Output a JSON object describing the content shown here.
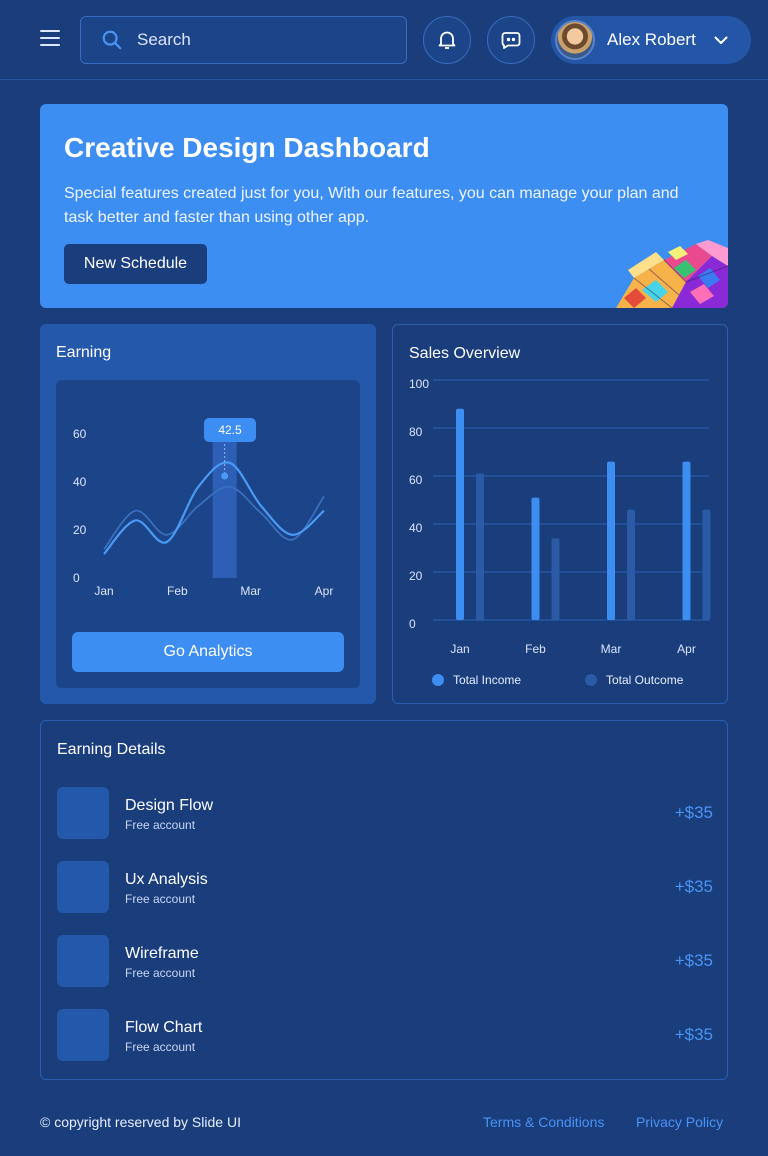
{
  "header": {
    "search_placeholder": "Search",
    "user_name": "Alex Robert"
  },
  "banner": {
    "title": "Creative Design Dashboard",
    "description": "Special features created just for you, With our features, you can manage your plan and task better and faster than using other app.",
    "button_label": "New Schedule"
  },
  "earning": {
    "title": "Earning",
    "tooltip": "42.5",
    "button_label": "Go Analytics"
  },
  "sales": {
    "title": "Sales Overview",
    "legend_income": "Total Income",
    "legend_outcome": "Total Outcome"
  },
  "chart_data": [
    {
      "type": "line",
      "title": "Earning",
      "categories": [
        "Jan",
        "Feb",
        "Mar",
        "Apr"
      ],
      "yticks": [
        0,
        20,
        40,
        60
      ],
      "ylim": [
        0,
        60
      ],
      "highlight": {
        "x": "Mar",
        "value": 42.5
      },
      "series": [
        {
          "values": [
            10,
            24,
            15,
            38,
            48,
            30,
            18,
            28
          ]
        },
        {
          "values": [
            12,
            28,
            18,
            30,
            38,
            27,
            16,
            34
          ]
        }
      ],
      "grid": false,
      "colors": [
        "#4a9af5",
        "#3a6fbf"
      ]
    },
    {
      "type": "bar",
      "title": "Sales Overview",
      "categories": [
        "Jan",
        "Feb",
        "Mar",
        "Apr"
      ],
      "yticks": [
        0,
        20,
        40,
        60,
        80,
        100
      ],
      "ylim": [
        0,
        100
      ],
      "series": [
        {
          "name": "Total Income",
          "values": [
            88,
            51,
            66,
            66
          ],
          "color": "#3d8ef2"
        },
        {
          "name": "Total Outcome",
          "values": [
            61,
            34,
            46,
            46
          ],
          "color": "#2b5aa6"
        }
      ],
      "grid": true,
      "legend": "bottom"
    }
  ],
  "details": {
    "title": "Earning Details",
    "items": [
      {
        "name": "Design Flow",
        "sub": "Free account",
        "amount": "+$35"
      },
      {
        "name": "Ux Analysis",
        "sub": "Free account",
        "amount": "+$35"
      },
      {
        "name": "Wireframe",
        "sub": "Free account",
        "amount": "+$35"
      },
      {
        "name": "Flow Chart",
        "sub": "Free account",
        "amount": "+$35"
      }
    ]
  },
  "footer": {
    "copyright": "© copyright reserved by Slide UI",
    "terms": "Terms & Conditions",
    "privacy": "Privacy Policy"
  }
}
